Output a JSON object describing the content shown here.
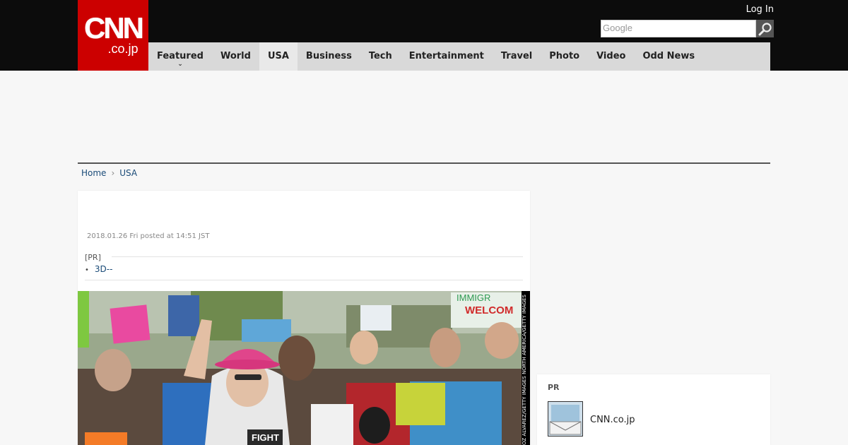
{
  "header": {
    "logo_main": "CNN",
    "logo_sub": ".co.jp",
    "login_label": "Log In",
    "search_placeholder": "Google"
  },
  "nav": {
    "items": [
      "Featured",
      "World",
      "USA",
      "Business",
      "Tech",
      "Entertainment",
      "Travel",
      "Photo",
      "Video",
      "Odd News"
    ],
    "active": "USA"
  },
  "breadcrumb": {
    "home": "Home",
    "current": "USA"
  },
  "article": {
    "date": "2018.01.26 Fri posted at 14:51 JST",
    "pr_label": "[PR]",
    "pr_link": "3D--",
    "photo_credit": "OZ ALVAREZ/GETTY IMAGES NORTH AMERICA/GETTY IMAGES",
    "sign_text_1": "IMMIGR",
    "sign_text_2": "WELCOM",
    "sign_text_3": "FIGHT"
  },
  "sidebar": {
    "pr_heading": "PR",
    "item_label": "CNN.co.jp"
  },
  "colors": {
    "brand_red": "#cc0000",
    "header_black": "#0c0c0c",
    "link_blue": "#1a4b78"
  }
}
